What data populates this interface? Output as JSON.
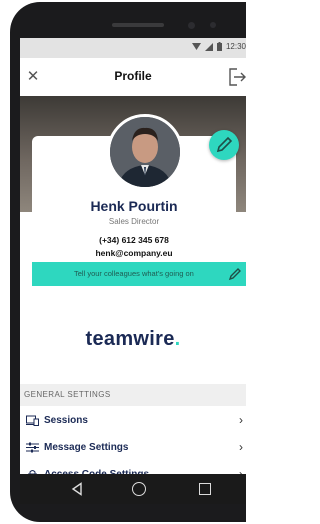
{
  "status_bar": {
    "time": "12:30"
  },
  "app_bar": {
    "title": "Profile"
  },
  "profile": {
    "name": "Henk Pourtin",
    "role": "Sales Director",
    "phone": "(+34) 612 345 678",
    "email": "henk@company.eu",
    "status_placeholder": "Tell your colleagues what's going on"
  },
  "brand": {
    "logo_text": "teamwire",
    "logo_dot": "."
  },
  "settings": {
    "section_title": "GENERAL SETTINGS",
    "items": [
      {
        "label": "Sessions",
        "icon": "devices-icon"
      },
      {
        "label": "Message Settings",
        "icon": "sliders-icon"
      },
      {
        "label": "Access Code Settings",
        "icon": "lock-icon"
      }
    ]
  },
  "colors": {
    "accent": "#2ed7bf",
    "brand": "#1b2a55"
  }
}
